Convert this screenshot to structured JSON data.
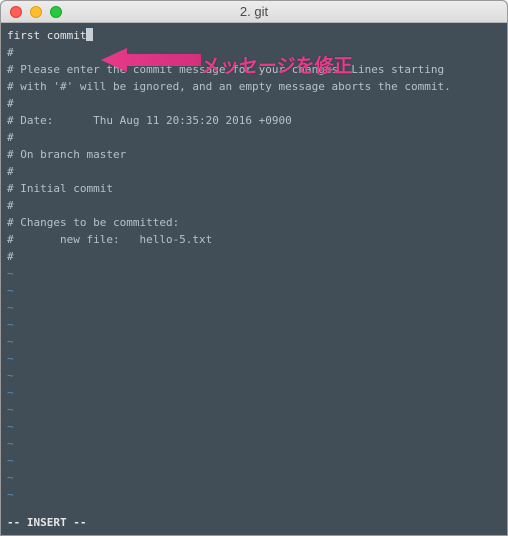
{
  "titlebar": {
    "title": "2. git"
  },
  "editor": {
    "commit_message": "first commit",
    "comment_lines": [
      "#",
      "# Please enter the commit message for your changes. Lines starting",
      "# with '#' will be ignored, and an empty message aborts the commit.",
      "#",
      "# Date:      Thu Aug 11 20:35:20 2016 +0900",
      "#",
      "# On branch master",
      "#",
      "# Initial commit",
      "#",
      "# Changes to be committed:",
      "#       new file:   hello-5.txt",
      "#"
    ],
    "tilde_count": 14,
    "status_line": "-- INSERT --"
  },
  "annotation": {
    "label": "メッセージを修正"
  },
  "colors": {
    "term_bg": "#414e58",
    "term_fg": "#e6e6e6",
    "tilde": "#5f8eb5",
    "annotation": "#e63a8a"
  }
}
